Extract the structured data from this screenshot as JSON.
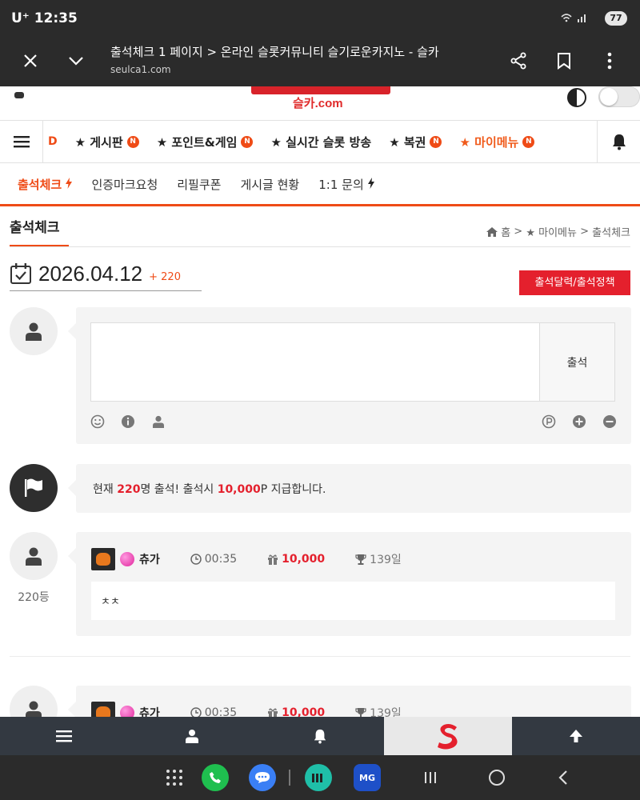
{
  "status_bar": {
    "carrier_time": "U⁺ 12:35",
    "signal_icons": "WiFi .ıl",
    "battery": "77"
  },
  "browser": {
    "close_icon": "close-icon",
    "title": "출석체크 1 페이지 > 온라인 슬롯커뮤니티 슬기로운카지노 - 슬카",
    "url": "seulca1.com"
  },
  "site": {
    "logo_sub": "슬카.com"
  },
  "main_nav": {
    "partial_item": "D",
    "items": [
      {
        "label": "★ 게시판",
        "badge": "N"
      },
      {
        "label": "★ 포인트&게임",
        "badge": "N"
      },
      {
        "label": "★ 실시간 슬롯 방송",
        "badge": ""
      },
      {
        "label": "★ 복권",
        "badge": "N"
      },
      {
        "label": "★ 마이메뉴",
        "badge": "N"
      }
    ]
  },
  "sub_nav": {
    "items": [
      "출석체크",
      "인증마크요청",
      "리필쿠폰",
      "게시글 현황",
      "1:1 문의"
    ]
  },
  "page": {
    "title": "출석체크",
    "breadcrumb": [
      "홈",
      "★ 마이메뉴",
      "출석체크"
    ]
  },
  "date_row": {
    "date": "2026.04.12",
    "plus": "+ 220",
    "calendar_button": "출석달력/출석정책"
  },
  "form": {
    "comment_value": "",
    "submit_label": "출석"
  },
  "notice": {
    "prefix": "현재 ",
    "count": "220",
    "mid": "명 출석! 출석시 ",
    "points": "10,000",
    "suffix": "P 지급합니다."
  },
  "entries": [
    {
      "rank": "220등",
      "nickname": "츄가",
      "time": "00:35",
      "points": "10,000",
      "days": "139일",
      "message": "ㅊㅊ"
    },
    {
      "rank": "",
      "nickname": "츄가",
      "time": "00:35",
      "points": "10,000",
      "days": "139일",
      "message": ""
    }
  ],
  "android_apps": {
    "mg_label": "MG"
  },
  "colors": {
    "accent": "#ef4b16",
    "red": "#e4202d",
    "dark_bar": "#2b2b2b"
  }
}
